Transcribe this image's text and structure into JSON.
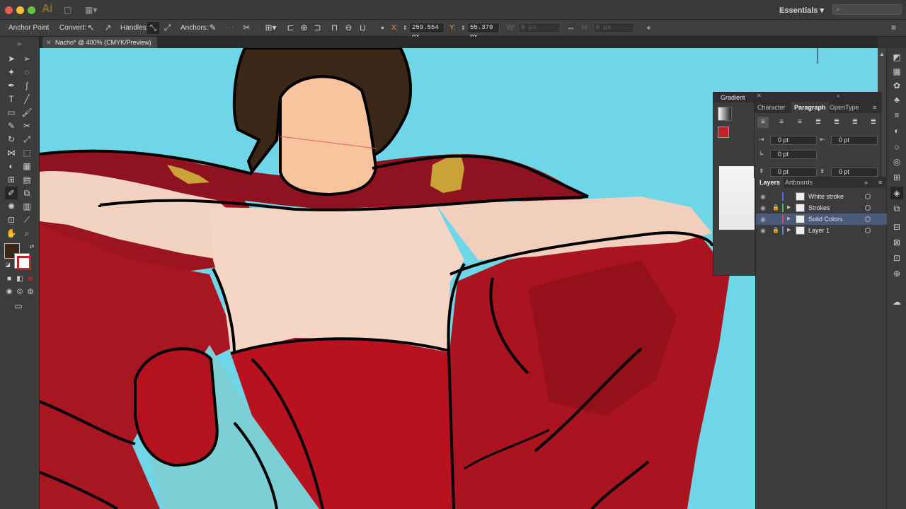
{
  "app": {
    "logo": "Ai",
    "workspace": "Essentials",
    "search_placeholder": ""
  },
  "control_bar": {
    "anchor_point_label": "Anchor Point",
    "convert_label": "Convert:",
    "handles_label": "Handles:",
    "anchors_label": "Anchors:",
    "x_label": "X:",
    "x_value": "259.554 px",
    "y_label": "Y:",
    "y_value": "55.379 px",
    "w_label": "W:",
    "w_value": "0 px",
    "h_label": "H:",
    "h_value": "0 px"
  },
  "document": {
    "tab_title": "Nacho* @ 400% (CMYK/Preview)"
  },
  "gradient_panel": {
    "title": "Gradient"
  },
  "paragraph_panel": {
    "tabs": [
      "Character",
      "Paragraph",
      "OpenType"
    ],
    "active_tab": "Paragraph",
    "left_indent": "0 pt",
    "right_indent": "0 pt",
    "first_line_indent": "0 pt",
    "space_before": "0 pt",
    "space_after": "0 pt"
  },
  "layers_panel": {
    "tabs": [
      "Layers",
      "Artboards"
    ],
    "active_tab": "Layers",
    "layers": [
      {
        "name": "White stroke",
        "color": "#4a6ef0",
        "selected": false,
        "locked": false
      },
      {
        "name": "Strokes",
        "color": "#44c04a",
        "selected": false,
        "locked": true
      },
      {
        "name": "Solid Colors",
        "color": "#e04a4a",
        "selected": true,
        "locked": false
      },
      {
        "name": "Layer 1",
        "color": "#4a8ae0",
        "selected": false,
        "locked": true
      }
    ]
  },
  "toolbar": {
    "fill_color": "#3b2718",
    "stroke_color": "#c0222a"
  },
  "canvas": {
    "background_color": "#6fd6e8"
  }
}
